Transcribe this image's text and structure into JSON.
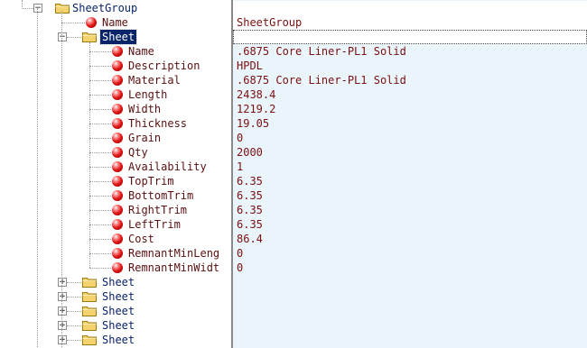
{
  "root": {
    "label": "SheetGroup",
    "expanded": true
  },
  "root_name": {
    "label": "Name",
    "value": "SheetGroup"
  },
  "sheet": {
    "label": "Sheet",
    "selected": true,
    "expanded": true,
    "properties": [
      {
        "label": "Name",
        "value": ".6875 Core Liner-PL1 Solid"
      },
      {
        "label": "Description",
        "value": "HPDL"
      },
      {
        "label": "Material",
        "value": ".6875 Core Liner-PL1 Solid"
      },
      {
        "label": "Length",
        "value": "2438.4"
      },
      {
        "label": "Width",
        "value": "1219.2"
      },
      {
        "label": "Thickness",
        "value": "19.05"
      },
      {
        "label": "Grain",
        "value": "0"
      },
      {
        "label": "Qty",
        "value": "2000"
      },
      {
        "label": "Availability",
        "value": "1"
      },
      {
        "label": "TopTrim",
        "value": "6.35"
      },
      {
        "label": "BottomTrim",
        "value": "6.35"
      },
      {
        "label": "RightTrim",
        "value": "6.35"
      },
      {
        "label": "LeftTrim",
        "value": "6.35"
      },
      {
        "label": "Cost",
        "value": "86.4"
      },
      {
        "label": "RemnantMinLeng",
        "value": "0"
      },
      {
        "label": "RemnantMinWidt",
        "value": "0"
      }
    ]
  },
  "collapsed_sheets": [
    "Sheet",
    "Sheet",
    "Sheet",
    "Sheet",
    "Sheet"
  ],
  "colors": {
    "selection": "#0a246a",
    "value_text": "#7a1010",
    "value_bg": "#eaf4fb",
    "ball": "#e01010",
    "folder": "#f3d36b"
  }
}
